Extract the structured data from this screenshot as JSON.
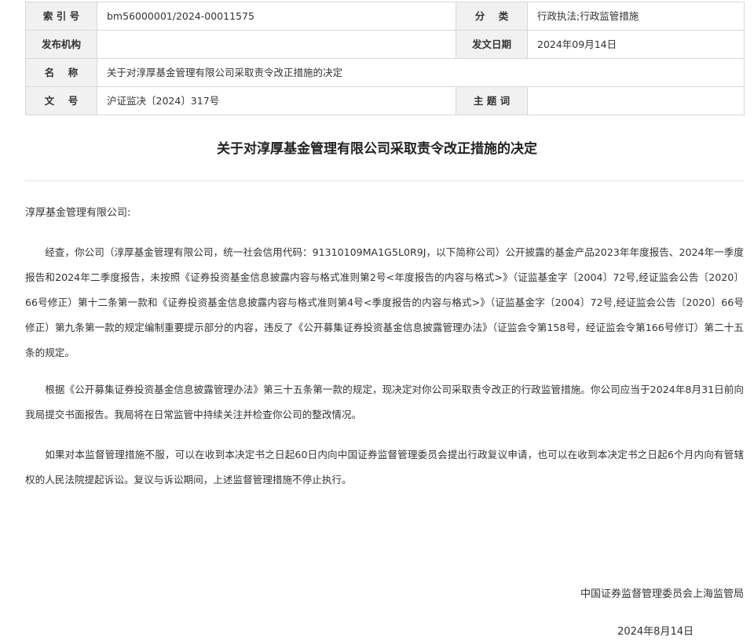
{
  "meta": {
    "index_label": "索 引 号",
    "index_value": "bm56000001/2024-00011575",
    "category_label": "分    类",
    "category_value": "行政执法;行政监管措施",
    "issuer_label": "发布机构",
    "issuer_value": "",
    "date_label": "发文日期",
    "date_value": "2024年09月14日",
    "name_label": "名    称",
    "name_value": "关于对淳厚基金管理有限公司采取责令改正措施的决定",
    "docno_label": "文    号",
    "docno_value": "沪证监决〔2024〕317号",
    "subject_label": "主 题 词",
    "subject_value": ""
  },
  "document": {
    "title": "关于对淳厚基金管理有限公司采取责令改正措施的决定",
    "salutation": "淳厚基金管理有限公司:",
    "paragraphs": [
      "经查，你公司（淳厚基金管理有限公司，统一社会信用代码：91310109MA1G5L0R9J，以下简称公司）公开披露的基金产品2023年年度报告、2024年一季度报告和2024年二季度报告，未按照《证券投资基金信息披露内容与格式准则第2号<年度报告的内容与格式>》（证监基金字〔2004〕72号,经证监会公告〔2020〕66号修正）第十二条第一款和《证券投资基金信息披露内容与格式准则第4号<季度报告的内容与格式>》（证监基金字〔2004〕72号,经证监会公告〔2020〕66号修正）第九条第一款的规定编制重要提示部分的内容，违反了《公开募集证券投资基金信息披露管理办法》（证监会令第158号，经证监会令第166号修订）第二十五条的规定。",
      "根据《公开募集证券投资基金信息披露管理办法》第三十五条第一款的规定，现决定对你公司采取责令改正的行政监管措施。你公司应当于2024年8月31日前向我局提交书面报告。我局将在日常监管中持续关注并检查你公司的整改情况。",
      "如果对本监督管理措施不服，可以在收到本决定书之日起60日内向中国证券监督管理委员会提出行政复议申请，也可以在收到本决定书之日起6个月内向有管辖权的人民法院提起诉讼。复议与诉讼期间，上述监督管理措施不停止执行。"
    ],
    "issuer": "中国证券监督管理委员会上海监管局",
    "date": "2024年8月14日"
  }
}
